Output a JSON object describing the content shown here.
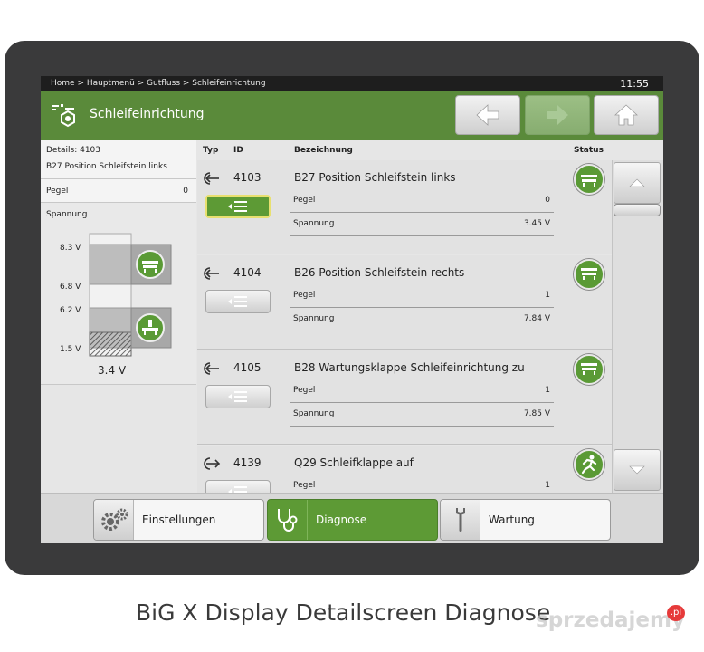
{
  "header": {
    "breadcrumb": "Home > Hauptmenü > Gutfluss > Schleifeinrichtung",
    "clock": "11:55",
    "title": "Schleifeinrichtung",
    "title_icon": "sharpener-icon",
    "nav": {
      "back_icon": "arrow-left-icon",
      "forward_icon": "arrow-right-icon",
      "home_icon": "home-icon"
    }
  },
  "columns": {
    "typ": "Typ",
    "id": "ID",
    "bezeichnung": "Bezeichnung",
    "status": "Status"
  },
  "left_panel": {
    "details_line1": "Details: 4103",
    "details_line2": "B27 Position Schleifstein links",
    "pegel_label": "Pegel",
    "pegel_value": "0",
    "spannung_label": "Spannung",
    "scale": [
      "8.3 V",
      "6.8 V",
      "6.2 V",
      "1.5 V"
    ],
    "current_voltage": "3.4 V"
  },
  "rows": [
    {
      "type_icon": "input-arrow-icon",
      "id": "4103",
      "name": "B27 Position Schleifstein links",
      "k1": "Pegel",
      "v1": "0",
      "k2": "Spannung",
      "v2": "3.45 V",
      "active": true
    },
    {
      "type_icon": "input-arrow-icon",
      "id": "4104",
      "name": "B26 Position Schleifstein rechts",
      "k1": "Pegel",
      "v1": "1",
      "k2": "Spannung",
      "v2": "7.84 V",
      "active": false
    },
    {
      "type_icon": "input-arrow-icon",
      "id": "4105",
      "name": "B28 Wartungsklappe Schleifeinrichtung zu",
      "k1": "Pegel",
      "v1": "1",
      "k2": "Spannung",
      "v2": "7.85 V",
      "active": false
    },
    {
      "type_icon": "output-arrow-icon",
      "id": "4139",
      "name": "Q29 Schleifklappe auf",
      "k1": "Pegel",
      "v1": "1",
      "k2": "",
      "v2": "",
      "active": false
    }
  ],
  "bottom_tabs": [
    {
      "label": "Einstellungen",
      "icon": "gears-icon",
      "active": false
    },
    {
      "label": "Diagnose",
      "icon": "stethoscope-icon",
      "active": true
    },
    {
      "label": "Wartung",
      "icon": "wrench-icon",
      "active": false
    }
  ],
  "caption": "BiG X Display Detailscreen Diagnose",
  "watermark": {
    "text": "sprzedajemy",
    "suffix": ".pl"
  },
  "colors": {
    "accent_green": "#5a8a3a",
    "active_green": "#5d9a35",
    "bezel": "#3a3a3b"
  }
}
